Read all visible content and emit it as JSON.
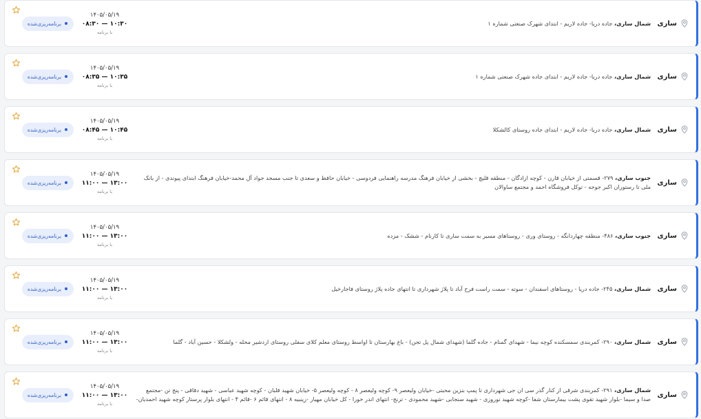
{
  "colors": {
    "accent": "#2f6fe0",
    "badge_bg": "#e8eefb",
    "badge_text": "#2f5fc4",
    "star": "#e0a233"
  },
  "icons": {
    "location": "map-pin-icon",
    "favorite": "star-outline-icon"
  },
  "items": [
    {
      "city": "ساری",
      "area": "شمال ساری،",
      "description": "جاده دریا- جاده لاریم - ابتدای شهرک صنعتی شماره ۱",
      "date": "۱۴۰۵/۰۵/۱۹",
      "time_range": "۰۸:۳۰ — ۱۰:۳۰",
      "time_note": "با برنامه",
      "status": "برنامه‌ریزی‌شده"
    },
    {
      "city": "ساری",
      "area": "شمال ساری،",
      "description": "جاده دریا- جاده لاریم - ابتدای جاده شهرک صنعتی شماره ۱",
      "date": "۱۴۰۵/۰۵/۱۹",
      "time_range": "۰۸:۳۵ — ۱۰:۳۵",
      "time_note": "با برنامه",
      "status": "برنامه‌ریزی‌شده"
    },
    {
      "city": "ساری",
      "area": "شمال ساری،",
      "description": "جاده دریا- جاده لاریم - ابتدای جاده روستای کالشکلا",
      "date": "۱۴۰۵/۰۵/۱۹",
      "time_range": "۰۸:۴۵ — ۱۰:۴۵",
      "time_note": "با برنامه",
      "status": "برنامه‌ریزی‌شده"
    },
    {
      "city": "ساری",
      "area": "جنوب ساری،",
      "description": "۲۷۹- قسمتی از خیابان قارن - کوچه ازادگان - منطقه قلیچ - بخشی از خیابان فرهنگ مدرسه راهنمایی فردوسی - خیابان حافظ و سعدی تا جنب مسجد جواد آل محمد-خیابان فرهنگ ابتدای پیوندی - از بانک ملی تا رستوران اکبر جوجه - توکل فروشگاه احمد و مجتمع ساوالان",
      "date": "۱۴۰۵/۰۵/۱۹",
      "time_range": "۱۱:۰۰ — ۱۳:۰۰",
      "time_note": "با برنامه",
      "status": "برنامه‌ریزی‌شده"
    },
    {
      "city": "ساری",
      "area": "جنوب ساری،",
      "description": "۴۸۶- منطقه چهاردانگه - روستای وری - روستاهای مسیر به سمت ساری تا کارنام - ششک - مزده",
      "date": "۱۴۰۵/۰۵/۱۹",
      "time_range": "۱۱:۰۰ — ۱۳:۰۰",
      "time_note": "با برنامه",
      "status": "برنامه‌ریزی‌شده"
    },
    {
      "city": "ساری",
      "area": "شمال ساری،",
      "description": "۲۴۵- جاده دریا - روستاهای اسفندان - سوته - سمت راست فرح آباد تا پلاژ شهرداری تا انتهای جاده پلاژ روستای فاجارخیل",
      "date": "۱۴۰۵/۰۵/۱۹",
      "time_range": "۱۱:۰۰ — ۱۳:۰۰",
      "time_note": "با برنامه",
      "status": "برنامه‌ریزی‌شده"
    },
    {
      "city": "ساری",
      "area": "شمال ساری،",
      "description": "۲۹۰- کمربندی سمسکنده کوچه نیما - شهدای گمنام - جاده گلما (شهدای شمال پل تجن) - باغ بهارستان تا اواسط روستای معلم کلای سفلی روستای اردشیر محله - ولشکلا - حسین آباد - گلما",
      "date": "۱۴۰۵/۰۵/۱۹",
      "time_range": "۱۱:۰۰ — ۱۳:۰۰",
      "time_note": "با برنامه",
      "status": "برنامه‌ریزی‌شده"
    },
    {
      "city": "ساری",
      "area": "شمال ساری،",
      "description": "۲۹۱- کمربندی شرقی از کنار گذر سی ان جی شهرداری تا پمپ بنزین محبتی -خیابان ولیعصر ۹- کوچه ولیعصر ۸ - کوچه ولیعصر ۵- خیابان شهید قلبان - کوچه شهید عباسی - شهید دقاقی - پنج تن -مجتمع صدا و سیما -بلوار شهید تقوی پشت بیمارستان شفا -کوچه شهید نوروزی - شهید سنجابی -شهید محمودی - ترنج- انتهای اندر خورا - کل خیابان مهیار -زینبیه ۸ - انتهای قائم ۶ -قائم ۴ - انتهای بلوار پرستار کوچه شهید احمدیان-",
      "date": "۱۴۰۵/۰۵/۱۹",
      "time_range": "۱۱:۰۰ — ۱۳:۰۰",
      "time_note": "با برنامه",
      "status": "برنامه‌ریزی‌شده"
    }
  ]
}
